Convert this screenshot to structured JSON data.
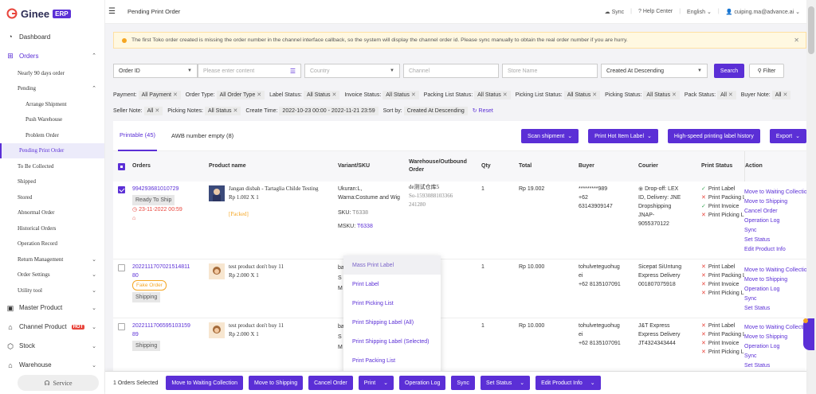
{
  "app": {
    "logo_text": "Ginee",
    "logo_badge": "ERP"
  },
  "sidebar": {
    "dashboard": "Dashboard",
    "orders": "Orders",
    "items": [
      {
        "label": "Nearly 90 days order",
        "level": 1
      },
      {
        "label": "Pending",
        "level": 1,
        "chevron": "up"
      },
      {
        "label": "Arrange Shipment",
        "level": 2
      },
      {
        "label": "Push Warehouse",
        "level": 2
      },
      {
        "label": "Problem Order",
        "level": 2
      },
      {
        "label": "Pending Print Order",
        "level": 1,
        "active": true
      },
      {
        "label": "To Be Collected",
        "level": 1
      },
      {
        "label": "Shipped",
        "level": 1
      },
      {
        "label": "Stored",
        "level": 1
      },
      {
        "label": "Abnormal Order",
        "level": 1
      },
      {
        "label": "Historical Orders",
        "level": 1
      },
      {
        "label": "Operation Record",
        "level": 1
      },
      {
        "label": "Return Management",
        "level": 1,
        "chevron": "down"
      },
      {
        "label": "Order Settings",
        "level": 1,
        "chevron": "down"
      },
      {
        "label": "Utility tool",
        "level": 1,
        "chevron": "down"
      }
    ],
    "master_product": "Master Product",
    "channel_product": "Channel Product",
    "hot_badge": "HOT",
    "stock": "Stock",
    "warehouse": "Warehouse",
    "service": "Service"
  },
  "topbar": {
    "title": "Pending Print Order",
    "sync": "Sync",
    "help": "Help Center",
    "language": "English",
    "user": "cuiping.ma@advance.ai"
  },
  "notice": {
    "text": "The first Toko order created is missing the order number in the channel interface callback, so the system will display the channel order id. Please sync manually to obtain the real order number if you are hurry."
  },
  "filters": {
    "field": "Order ID",
    "content_placeholder": "Please enter content",
    "country_placeholder": "Country",
    "channel_placeholder": "Channel",
    "store_placeholder": "Store Name",
    "sort": "Created At Descending",
    "search": "Search",
    "filter": "Filter"
  },
  "chips": [
    {
      "label": "Payment:",
      "value": "All Payment"
    },
    {
      "label": "Order Type:",
      "value": "All Order Type"
    },
    {
      "label": "Label Status:",
      "value": "All Status"
    },
    {
      "label": "Invoice Status:",
      "value": "All Status"
    },
    {
      "label": "Packing List Status:",
      "value": "All Status"
    },
    {
      "label": "Picking List Status:",
      "value": "All Status"
    },
    {
      "label": "Picking Status:",
      "value": "All Status"
    },
    {
      "label": "Pack Status:",
      "value": "All"
    },
    {
      "label": "Buyer Note:",
      "value": "All"
    },
    {
      "label": "Seller Note:",
      "value": "All"
    },
    {
      "label": "Picking Notes:",
      "value": "All Status"
    },
    {
      "label": "Create Time:",
      "value": "2022-10-23 00:00 - 2022-11-21 23:59",
      "nox": true
    },
    {
      "label": "Sort by:",
      "value": "Created At Descending",
      "nox": true
    }
  ],
  "reset": "Reset",
  "tabs": [
    {
      "label": "Printable (45)",
      "active": true
    },
    {
      "label": "AWB number empty (8)",
      "active": false
    }
  ],
  "tab_actions": {
    "scan": "Scan shipment",
    "hot": "Print Hot Item Label",
    "history": "High-speed printing label history",
    "export": "Export"
  },
  "columns": {
    "orders": "Orders",
    "product": "Product name",
    "variant": "Variant/SKU",
    "warehouse": "Warehouse/Outbound Order",
    "qty": "Qty",
    "total": "Total",
    "buyer": "Buyer",
    "courier": "Courier",
    "print_status": "Print Status",
    "action": "Action"
  },
  "rows": [
    {
      "order_id": "994293681010729",
      "status_tag": "Ready To Ship",
      "time": "23-11-2022 00:59",
      "product": "Jangan disbah - Tartaglia Childe Testing",
      "price": "Rp 1.002 X 1",
      "packed": "[Packed]",
      "variant1": "Ukuran:L,",
      "variant2": "Warna:Costume and Wig",
      "sku_label": "SKU:",
      "sku": "T6338",
      "msku_label": "MSKU:",
      "msku": "T6338",
      "warehouse": "de测试仓库5",
      "outbound1": "So-1593088103366",
      "outbound2": "241280",
      "qty": "1",
      "total": "Rp 19.002",
      "buyer1": "*********989",
      "buyer2": "+62",
      "buyer3": "63143909147",
      "courier1": "Drop-off: LEX",
      "courier2": "ID, Delivery: JNE",
      "courier3": "Dropshipping",
      "courier4": "JNAP-",
      "courier5": "9055370122",
      "print": [
        {
          "ok": true,
          "text": "Print Label"
        },
        {
          "ok": false,
          "text": "Print Packing List"
        },
        {
          "ok": true,
          "text": "Print Invoice"
        },
        {
          "ok": false,
          "text": "Print Picking List"
        }
      ],
      "actions": [
        "Move to Waiting Collection",
        "Move to Shipping",
        "Cancel Order",
        "Operation Log",
        "Sync",
        "Set Status",
        "Edit Product Info"
      ]
    },
    {
      "order_id": "2022111707021514811",
      "order_id2": "80",
      "fake_tag": "Fake Order",
      "status_tag": "Shipping",
      "product": "test product don't buy 11",
      "price": "Rp 2.000 X 1",
      "variant1": "ba",
      "variant2": "S",
      "variant3": "M",
      "qty": "1",
      "total": "Rp 10.000",
      "buyer1": "tohulveteguohug",
      "buyer2": "ei",
      "buyer3": "+62 8135107091",
      "courier1": "Sicepat SiUntung",
      "courier2": "Express Delivery",
      "courier3": "001807075918",
      "print": [
        {
          "ok": false,
          "text": "Print Label"
        },
        {
          "ok": false,
          "text": "Print Packing List"
        },
        {
          "ok": false,
          "text": "Print Invoice"
        },
        {
          "ok": false,
          "text": "Print Picking List"
        }
      ],
      "actions": [
        "Move to Waiting Collection",
        "Move to Shipping",
        "Operation Log",
        "Sync",
        "Set Status"
      ]
    },
    {
      "order_id": "2022111706595103159",
      "order_id2": "89",
      "status_tag": "Shipping",
      "product": "test product don't buy 11",
      "price": "Rp 2.000 X 1",
      "variant1": "ba",
      "variant2": "S",
      "variant3": "M",
      "qty": "1",
      "total": "Rp 10.000",
      "buyer1": "tohulveteguohug",
      "buyer2": "ei",
      "buyer3": "+62 8135107091",
      "courier1": "J&T Express",
      "courier2": "Express Delivery",
      "courier3": "JT4324343444",
      "print": [
        {
          "ok": false,
          "text": "Print Label"
        },
        {
          "ok": false,
          "text": "Print Packing List"
        },
        {
          "ok": false,
          "text": "Print Invoice"
        },
        {
          "ok": false,
          "text": "Print Picking List"
        }
      ],
      "actions": [
        "Move to Waiting Collection",
        "Move to Shipping",
        "Operation Log",
        "Sync",
        "Set Status"
      ]
    }
  ],
  "print_menu": [
    "Mass Print Label",
    "Print Label",
    "Print Picking List",
    "Print Shipping Label (All)",
    "Print Shipping Label (Selected)",
    "Print Packing List"
  ],
  "bottom": {
    "selected": "1 Orders Selected",
    "buttons": [
      "Move to Waiting Collection",
      "Move to Shipping",
      "Cancel Order",
      "Print",
      "Operation Log",
      "Sync",
      "Set Status",
      "Edit Product Info"
    ]
  },
  "colors": {
    "accent": "#5b2fd6",
    "error": "#e8453c",
    "success": "#3aa757",
    "warning": "#f5a623"
  }
}
